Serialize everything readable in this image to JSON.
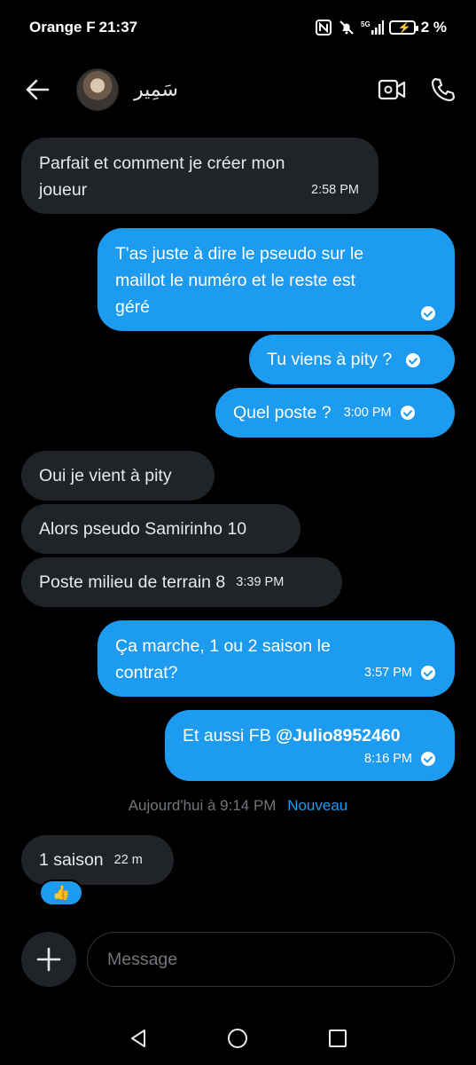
{
  "status_bar": {
    "carrier": "Orange F",
    "time": "21:37",
    "network": "5G",
    "battery": "2 %"
  },
  "header": {
    "contact_name": "سَمِير",
    "icons": [
      "back-arrow-icon",
      "video-call-icon",
      "phone-icon"
    ]
  },
  "messages": [
    {
      "dir": "in",
      "lines": [
        "Parfait et comment je créer mon",
        "joueur"
      ],
      "time": "2:58 PM"
    },
    {
      "dir": "out",
      "lines": [
        "T'as juste à dire le pseudo sur le",
        "maillot le numéro et le reste est",
        "géré"
      ],
      "time": "",
      "read": true
    },
    {
      "dir": "out",
      "lines": [
        "Tu viens à pity ?"
      ],
      "time": "",
      "read": true
    },
    {
      "dir": "out",
      "lines": [
        "Quel poste ?"
      ],
      "time": "3:00 PM",
      "read": true
    },
    {
      "dir": "in",
      "lines": [
        "Oui je vient à pity"
      ],
      "time": ""
    },
    {
      "dir": "in",
      "lines": [
        "Alors pseudo Samirinho 10"
      ],
      "time": ""
    },
    {
      "dir": "in",
      "lines": [
        "Poste milieu de terrain 8"
      ],
      "time": "3:39 PM"
    },
    {
      "dir": "out",
      "lines": [
        "Ça marche, 1 ou 2 saison le",
        "contrat?"
      ],
      "time": "3:57 PM",
      "read": true
    },
    {
      "dir": "out",
      "text_prefix": "Et aussi FB ",
      "mention": "@Julio8952460",
      "time": "8:16 PM",
      "read": true
    }
  ],
  "divider": {
    "label": "Aujourd'hui à 9:14 PM",
    "new_label": "Nouveau"
  },
  "last_message": {
    "text": "1 saison",
    "time": "22 m",
    "reaction": "👍"
  },
  "composer": {
    "placeholder": "Message"
  },
  "colors": {
    "accent": "#1d9bf0",
    "incoming_bubble": "#202327",
    "background": "#000000",
    "muted_text": "#71767b"
  }
}
